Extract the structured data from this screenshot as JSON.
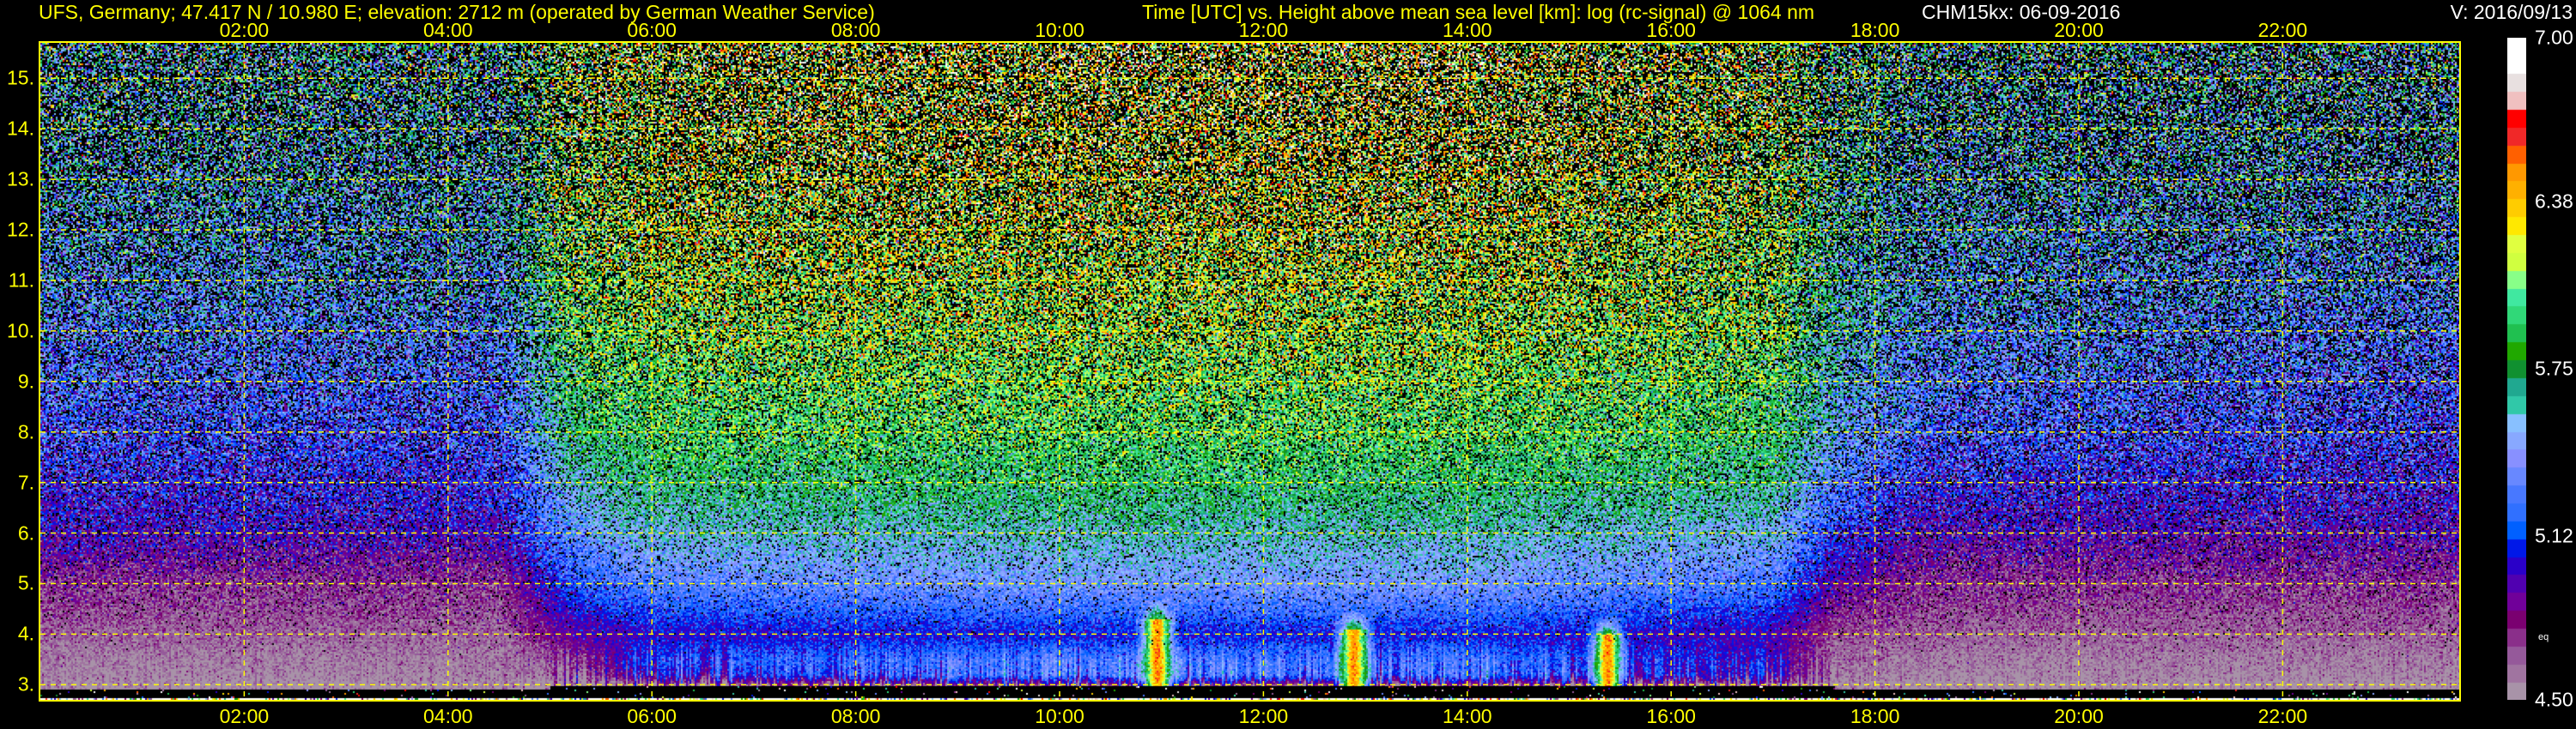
{
  "header": {
    "site_title": "UFS, Germany; 47.417 N / 10.980 E; elevation: 2712 m  (operated by German Weather Service)",
    "plot_title": "Time [UTC] vs. Height above mean sea level [km]: log (rc-signal) @ 1064 nm",
    "instrument_date": "CHM15kx: 06-09-2016",
    "version": "V: 2016/09/13"
  },
  "colors": {
    "axis": "#ffff00",
    "background": "#000000",
    "text_white": "#ffffff"
  },
  "chart_data": {
    "type": "heatmap",
    "title": "Time [UTC] vs. Height above mean sea level [km]: log (rc-signal) @ 1064 nm",
    "xlabel": "Time [UTC]",
    "ylabel": "Height above mean sea level [km]",
    "xlim_hours": [
      0,
      23.7
    ],
    "ylim": [
      2.7,
      15.7
    ],
    "grid": true,
    "x_tick_labels": [
      "02:00",
      "04:00",
      "06:00",
      "08:00",
      "10:00",
      "12:00",
      "14:00",
      "16:00",
      "18:00",
      "20:00",
      "22:00"
    ],
    "x_tick_hours": [
      2,
      4,
      6,
      8,
      10,
      12,
      14,
      16,
      18,
      20,
      22
    ],
    "y_tick_labels": [
      "3.",
      "4.",
      "5.",
      "6.",
      "7.",
      "8.",
      "9.",
      "10.",
      "11.",
      "12.",
      "13.",
      "14.",
      "15."
    ],
    "y_tick_values": [
      3,
      4,
      5,
      6,
      7,
      8,
      9,
      10,
      11,
      12,
      13,
      14,
      15
    ],
    "colorbar": {
      "range": [
        4.5,
        7.0
      ],
      "tick_labels": [
        "7.00",
        "6.38",
        "5.75",
        "5.12",
        "4.50"
      ],
      "tick_values": [
        7.0,
        6.38,
        5.75,
        5.12,
        4.5
      ],
      "note_label": "eq",
      "colors_bottom_to_top": [
        "#a893a8",
        "#a074a0",
        "#95599a",
        "#8a2f8a",
        "#7a0070",
        "#700099",
        "#5000b0",
        "#2a00c8",
        "#0018e8",
        "#0060ff",
        "#3070ff",
        "#4878ff",
        "#6888ff",
        "#8890ff",
        "#88a8ff",
        "#88c0ff",
        "#30c8a8",
        "#20a890",
        "#109030",
        "#20a800",
        "#20c050",
        "#30d878",
        "#40e8a0",
        "#88ff88",
        "#d0ff40",
        "#e0ff40",
        "#ffe800",
        "#ffcc00",
        "#ffb000",
        "#ff9800",
        "#ff6000",
        "#f02828",
        "#ff0000",
        "#f0c0c0",
        "#e8e0e0",
        "#ffffff",
        "#ffffff"
      ]
    },
    "profile_heights_km": [
      2.9,
      3.2,
      3.5,
      4.0,
      5.0,
      6.0,
      7.0,
      8.0,
      10.0,
      12.0,
      14.0,
      15.5
    ],
    "profiles_by_hour": {
      "hours": [
        0.5,
        4.5,
        5.2,
        6.0,
        10.0,
        14.0,
        17.0,
        17.6,
        18.5,
        23.5
      ],
      "values": [
        [
          4.5,
          4.55,
          4.58,
          4.65,
          4.75,
          4.95,
          5.05,
          5.15,
          5.3,
          5.45,
          5.55,
          5.6
        ],
        [
          4.5,
          4.55,
          4.58,
          4.65,
          4.75,
          4.95,
          5.05,
          5.15,
          5.3,
          5.45,
          5.55,
          5.6
        ],
        [
          4.5,
          4.62,
          4.7,
          4.9,
          5.15,
          5.35,
          5.55,
          5.75,
          5.95,
          6.05,
          6.1,
          6.1
        ],
        [
          4.5,
          5.05,
          5.15,
          5.0,
          5.3,
          5.55,
          5.75,
          5.9,
          6.05,
          6.15,
          6.2,
          6.2
        ],
        [
          4.5,
          5.3,
          5.3,
          5.05,
          5.4,
          5.6,
          5.8,
          5.95,
          6.1,
          6.2,
          6.3,
          6.3
        ],
        [
          4.5,
          5.25,
          5.25,
          5.05,
          5.4,
          5.6,
          5.8,
          5.95,
          6.1,
          6.2,
          6.3,
          6.3
        ],
        [
          4.5,
          4.95,
          5.0,
          4.95,
          5.25,
          5.5,
          5.7,
          5.85,
          6.0,
          6.05,
          6.1,
          6.1
        ],
        [
          4.5,
          4.6,
          4.62,
          4.7,
          4.9,
          5.1,
          5.3,
          5.45,
          5.6,
          5.7,
          5.75,
          5.75
        ],
        [
          4.5,
          4.55,
          4.58,
          4.65,
          4.75,
          4.9,
          5.05,
          5.2,
          5.35,
          5.45,
          5.55,
          5.6
        ],
        [
          4.5,
          4.55,
          4.58,
          4.65,
          4.75,
          4.9,
          5.0,
          5.1,
          5.25,
          5.4,
          5.5,
          5.55
        ]
      ]
    },
    "plumes": [
      {
        "time": "10:55",
        "hours": 10.95,
        "top_km": 4.3,
        "peak": 6.55
      },
      {
        "time": "12:53",
        "hours": 12.88,
        "top_km": 4.1,
        "peak": 6.6
      },
      {
        "time": "15:22",
        "hours": 15.37,
        "top_km": 4.0,
        "peak": 6.45
      }
    ]
  }
}
